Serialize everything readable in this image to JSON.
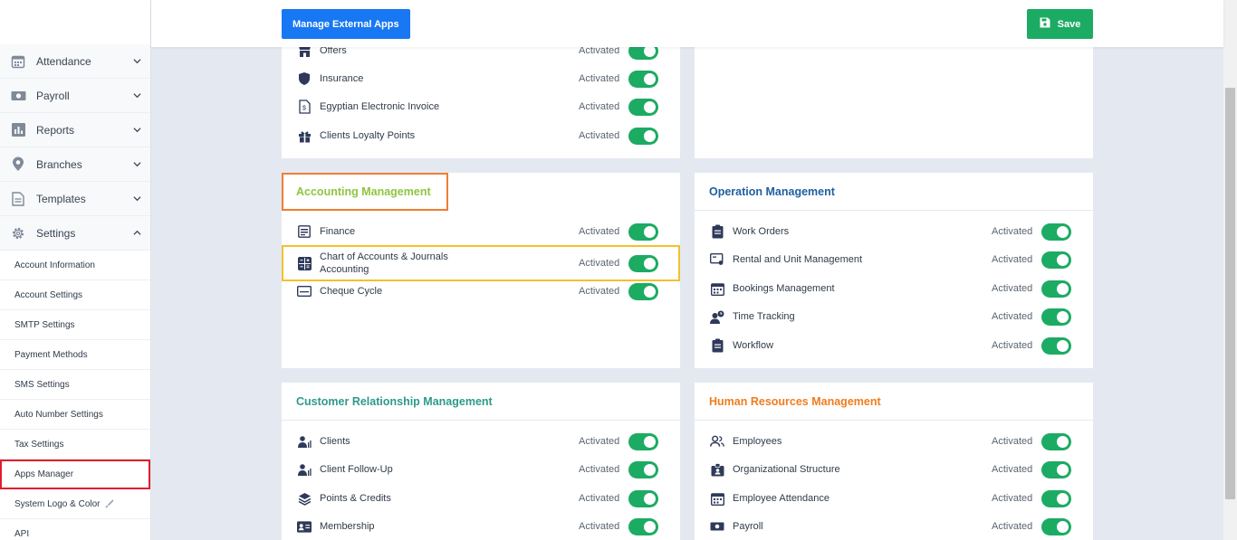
{
  "header": {
    "manage_label": "Manage External Apps",
    "save_label": "Save"
  },
  "sidebar": {
    "nav": [
      {
        "label": "Attendance",
        "icon": "calendar-icon"
      },
      {
        "label": "Payroll",
        "icon": "money-icon"
      },
      {
        "label": "Reports",
        "icon": "bar-chart-icon"
      },
      {
        "label": "Branches",
        "icon": "map-pin-icon"
      },
      {
        "label": "Templates",
        "icon": "document-icon"
      },
      {
        "label": "Settings",
        "icon": "gear-icon"
      }
    ],
    "sub": [
      "Account Information",
      "Account Settings",
      "SMTP Settings",
      "Payment Methods",
      "SMS Settings",
      "Auto Number Settings",
      "Tax Settings",
      "Apps Manager",
      "System Logo & Color",
      "API"
    ]
  },
  "status_label": "Activated",
  "cards": {
    "top_left": {
      "items": [
        "Offers",
        "Insurance",
        "Egyptian Electronic Invoice",
        "Clients Loyalty Points"
      ]
    },
    "accounting": {
      "title": "Accounting Management",
      "title_color": "#8cc63f",
      "items": [
        "Finance",
        "Chart of Accounts & Journals",
        "Accounting",
        "Cheque Cycle"
      ]
    },
    "operation": {
      "title": "Operation Management",
      "title_color": "#1f5fa0",
      "items": [
        "Work Orders",
        "Rental and Unit Management",
        "Bookings Management",
        "Time Tracking",
        "Workflow"
      ]
    },
    "crm": {
      "title": "Customer Relationship Management",
      "title_color": "#2e9a8a",
      "items": [
        "Clients",
        "Client Follow-Up",
        "Points & Credits",
        "Membership"
      ]
    },
    "hr": {
      "title": "Human Resources Management",
      "title_color": "#f07c1c",
      "items": [
        "Employees",
        "Organizational Structure",
        "Employee Attendance",
        "Payroll"
      ]
    }
  },
  "colors": {
    "toggle_on": "#1cab63",
    "manage_button": "#1877f2",
    "save_button": "#1cab63",
    "active_outline": "#e11d2d"
  }
}
